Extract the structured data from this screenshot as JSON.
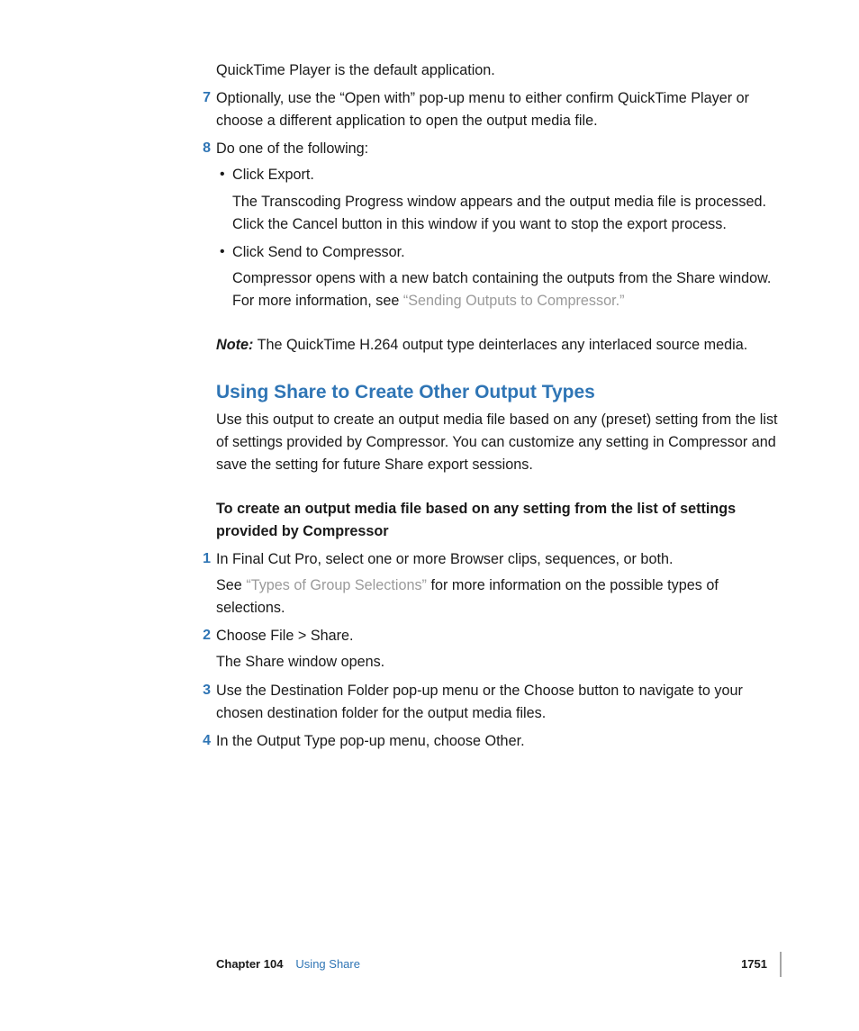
{
  "intro_line": "QuickTime Player is the default application.",
  "step7": {
    "num": "7",
    "text": "Optionally, use the “Open with” pop-up menu to either confirm QuickTime Player or choose a different application to open the output media file."
  },
  "step8": {
    "num": "8",
    "text": "Do one of the following:",
    "bullets": [
      {
        "lead": "Click Export.",
        "follow": "The Transcoding Progress window appears and the output media file is processed. Click the Cancel button in this window if you want to stop the export process."
      },
      {
        "lead": "Click Send to Compressor.",
        "follow_prefix": "Compressor opens with a new batch containing the outputs from the Share window. For more information, see ",
        "follow_link": "“Sending Outputs to Compressor.”"
      }
    ]
  },
  "note": {
    "label": "Note:",
    "text": "  The QuickTime H.264 output type deinterlaces any interlaced source media."
  },
  "heading": "Using Share to Create Other Output Types",
  "heading_para": "Use this output to create an output media file based on any (preset) setting from the list of settings provided by Compressor. You can customize any setting in Compressor and save the setting for future Share export sessions.",
  "task_heading": "To create an output media file based on any setting from the list of settings provided by Compressor",
  "t1": {
    "num": "1",
    "text": "In Final Cut Pro, select one or more Browser clips, sequences, or both.",
    "after_prefix": "See ",
    "after_link": "“Types of Group Selections”",
    "after_suffix": " for more information on the possible types of selections."
  },
  "t2": {
    "num": "2",
    "text": "Choose File > Share.",
    "after": "The Share window opens."
  },
  "t3": {
    "num": "3",
    "text": "Use the Destination Folder pop-up menu or the Choose button to navigate to your chosen destination folder for the output media files."
  },
  "t4": {
    "num": "4",
    "text": "In the Output Type pop-up menu, choose Other."
  },
  "footer": {
    "chapter_label": "Chapter 104",
    "chapter_title": "Using Share",
    "page": "1751"
  }
}
